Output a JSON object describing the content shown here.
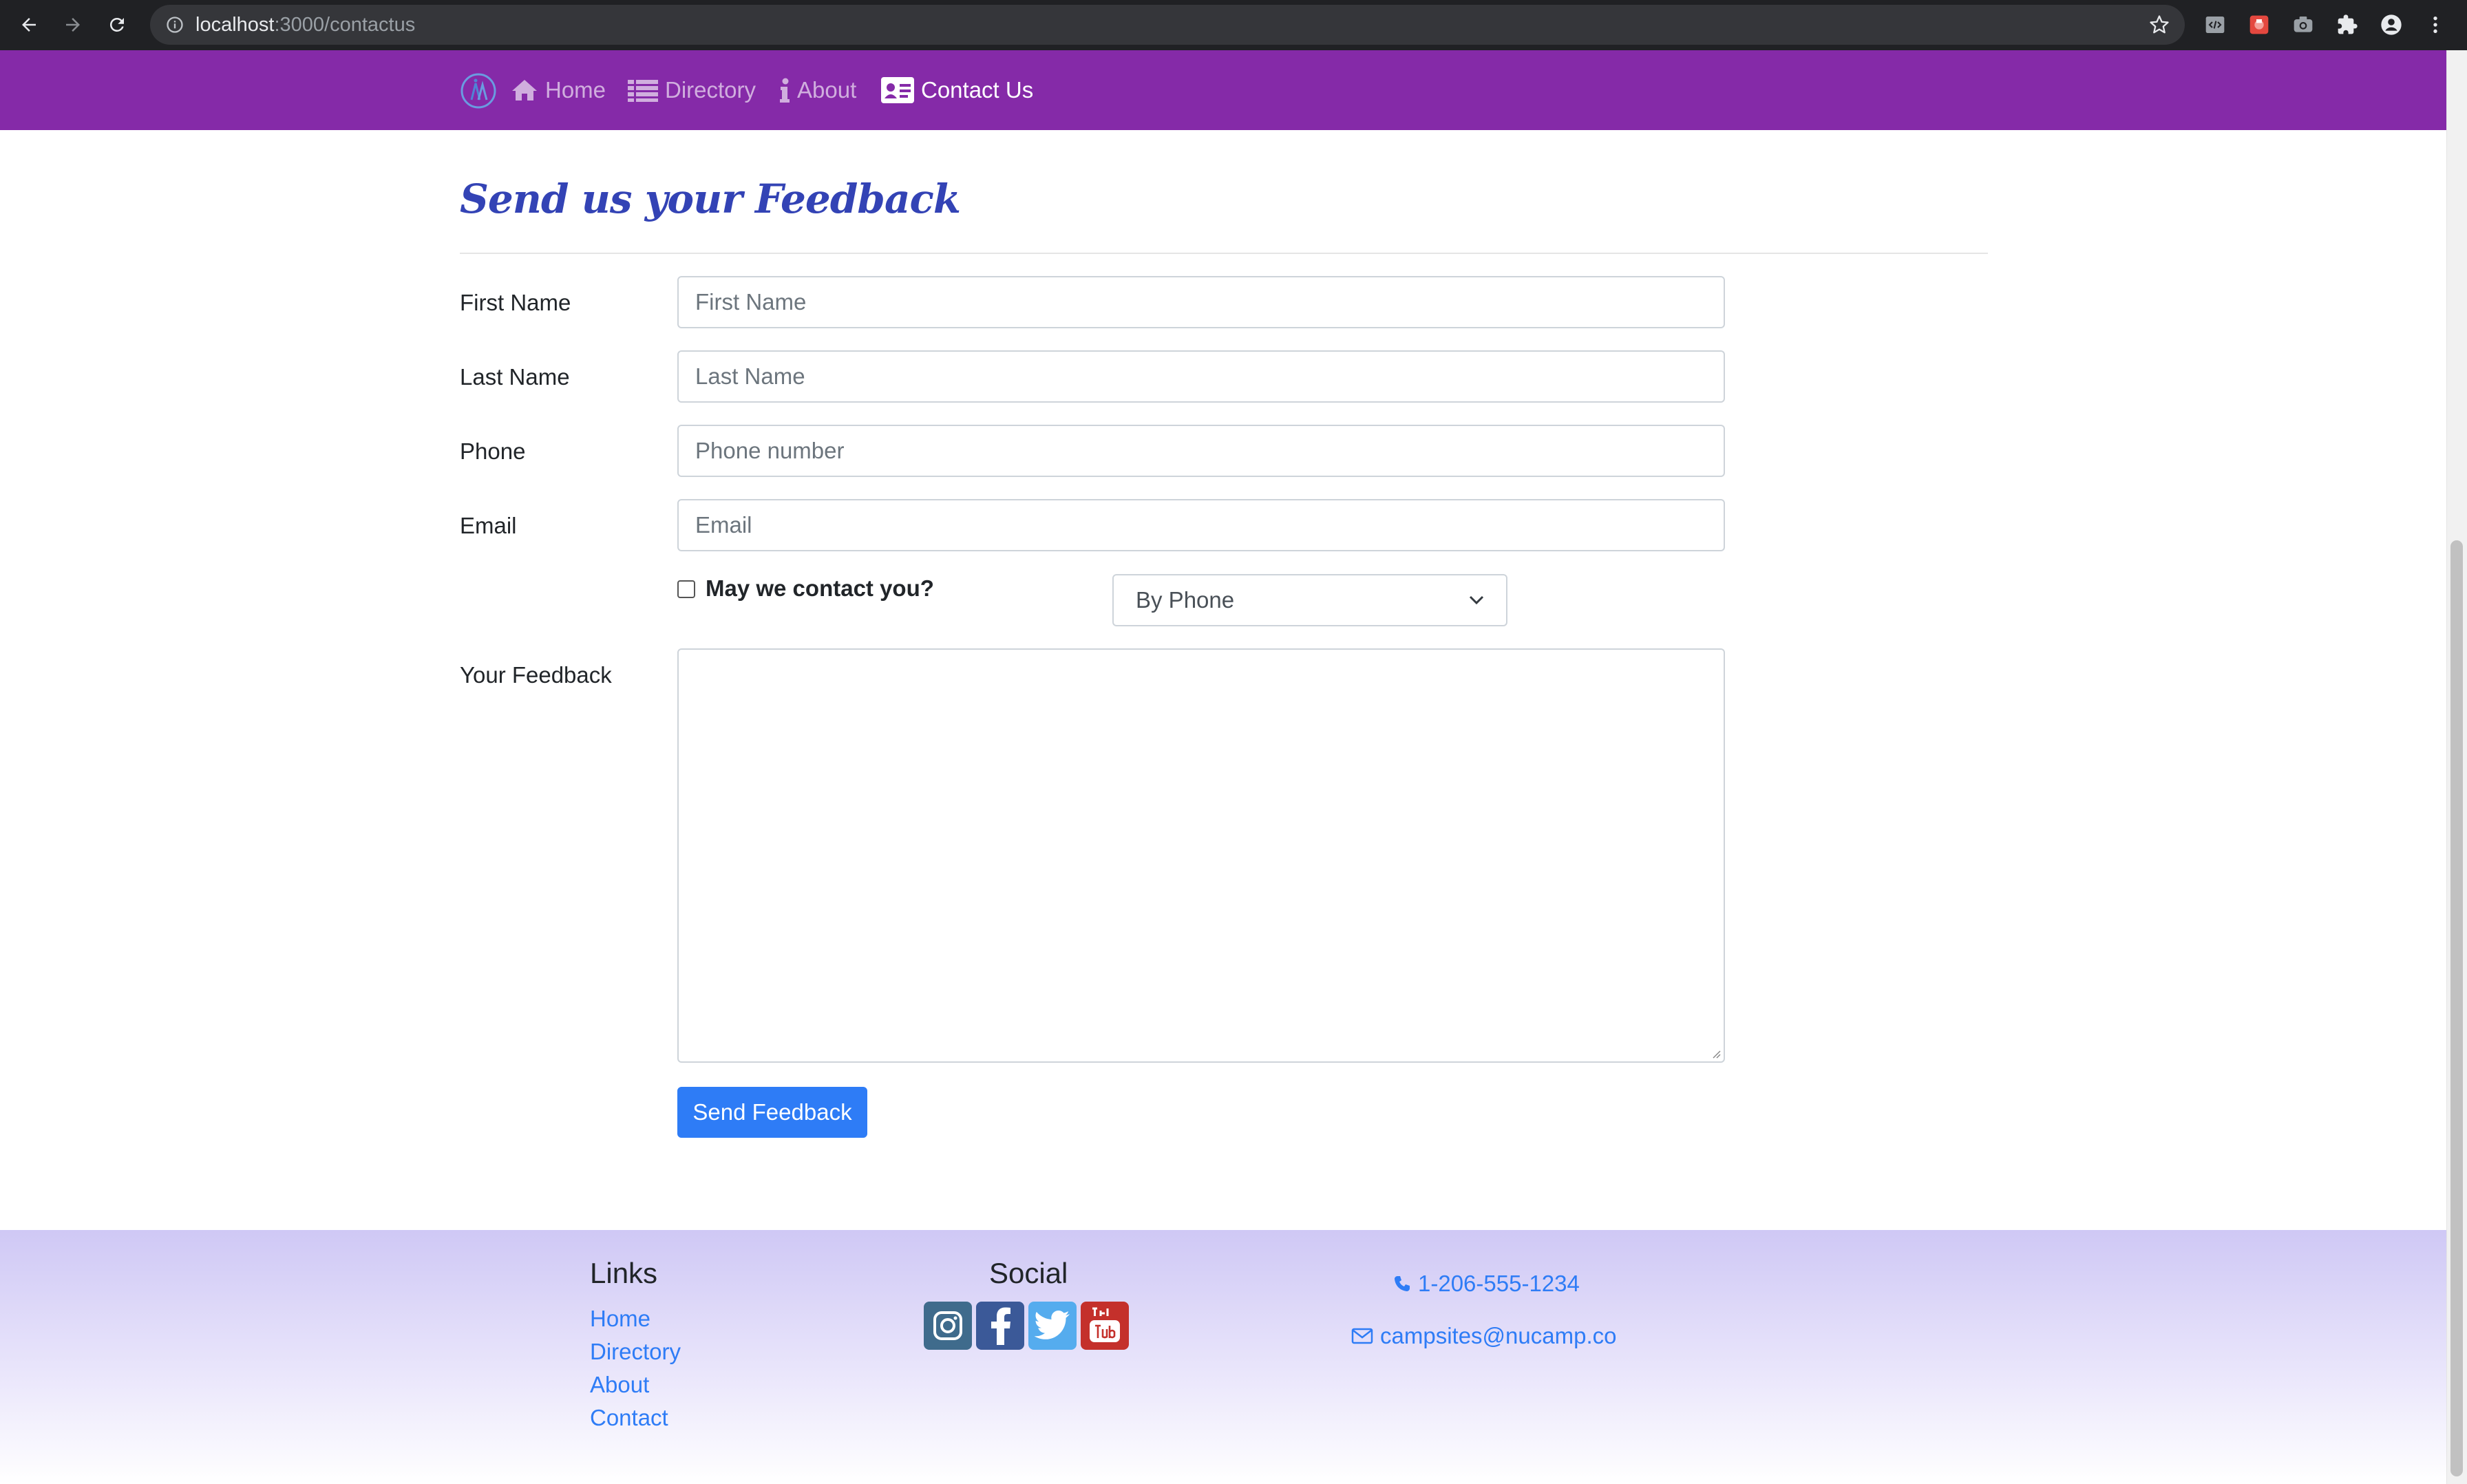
{
  "browser": {
    "url_host": "localhost",
    "url_path": ":3000/contactus"
  },
  "nav": {
    "items": [
      {
        "label": "Home",
        "icon": "home-icon"
      },
      {
        "label": "Directory",
        "icon": "list-icon"
      },
      {
        "label": "About",
        "icon": "info-icon"
      },
      {
        "label": "Contact Us",
        "icon": "address-card-icon",
        "active": true
      }
    ],
    "background": "#852aa8"
  },
  "form": {
    "title": "Send us your Feedback",
    "fields": [
      {
        "label": "First Name",
        "placeholder": "First Name",
        "value": ""
      },
      {
        "label": "Last Name",
        "placeholder": "Last Name",
        "value": ""
      },
      {
        "label": "Phone",
        "placeholder": "Phone number",
        "value": ""
      },
      {
        "label": "Email",
        "placeholder": "Email",
        "value": ""
      }
    ],
    "contact_checkbox_label": "May we contact you?",
    "contact_checked": false,
    "contact_method_selected": "By Phone",
    "feedback_label": "Your Feedback",
    "feedback_value": "",
    "submit_label": "Send Feedback"
  },
  "footer": {
    "links_heading": "Links",
    "links": [
      "Home",
      "Directory",
      "About",
      "Contact"
    ],
    "social_heading": "Social",
    "social": [
      {
        "name": "instagram-icon",
        "color": "#3f6b8c"
      },
      {
        "name": "facebook-icon",
        "color": "#3b5998"
      },
      {
        "name": "twitter-icon",
        "color": "#55acee"
      },
      {
        "name": "youtube-icon",
        "color": "#c4302b"
      }
    ],
    "phone": "1-206-555-1234",
    "email": "campsites@nucamp.co"
  },
  "colors": {
    "accent": "#2e7cf6",
    "title": "#3343b5"
  }
}
